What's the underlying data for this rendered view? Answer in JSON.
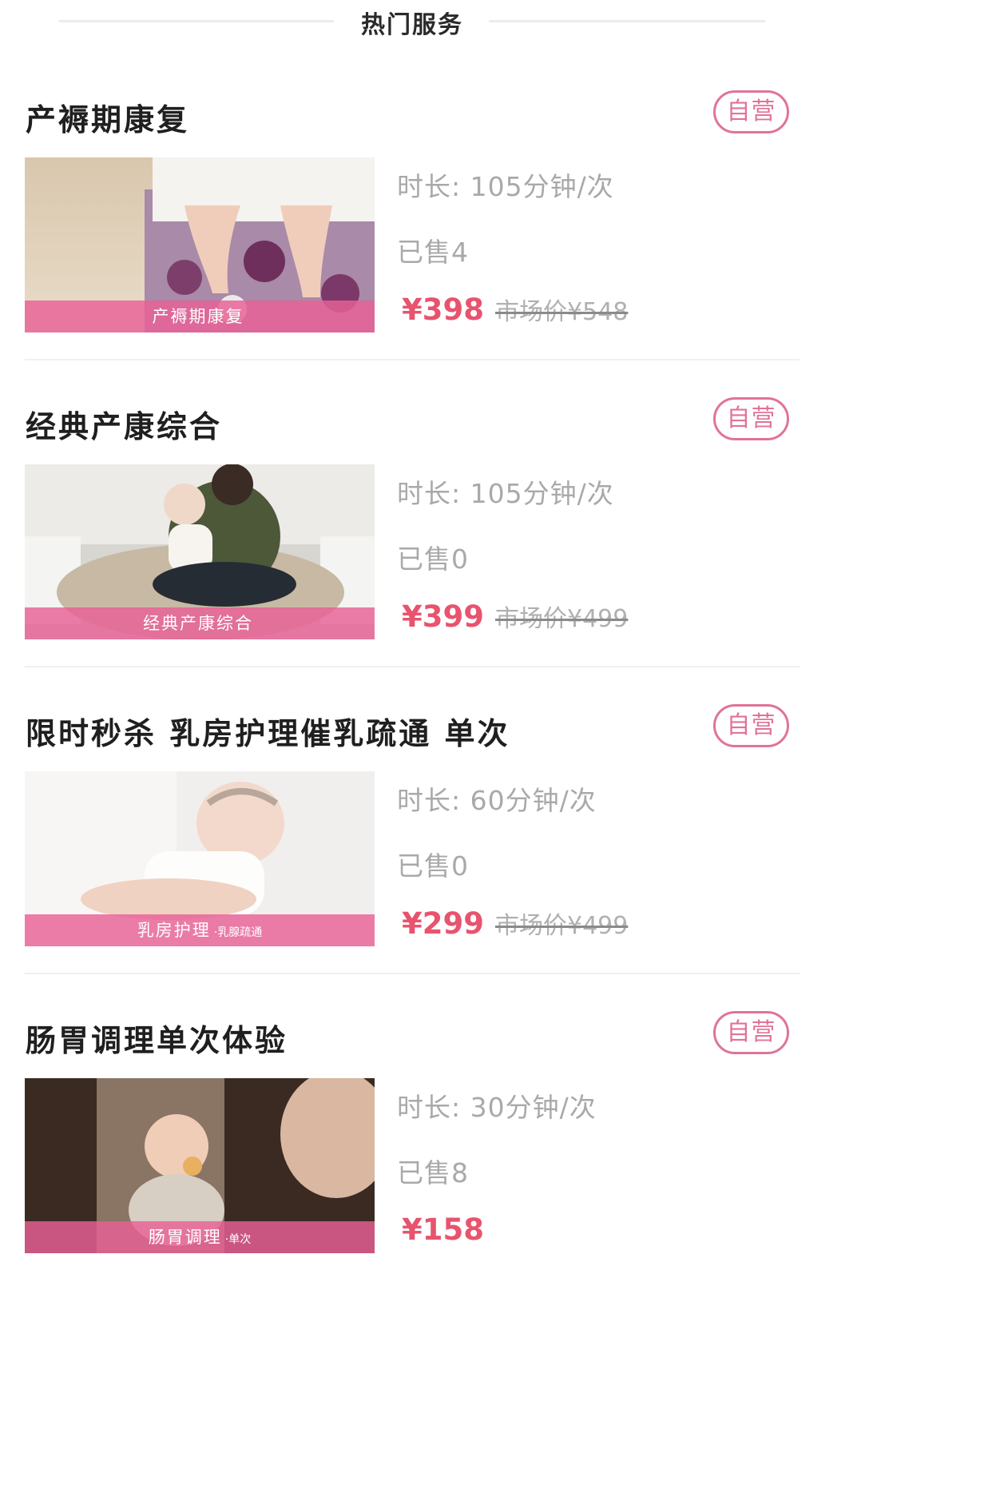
{
  "section": {
    "title": "热门服务"
  },
  "cards": [
    {
      "title": "产褥期康复",
      "badge": "自营",
      "caption": "产褥期康复",
      "caption_sub": "",
      "duration": "时长: 105分钟/次",
      "sold": "已售4",
      "price": "¥398",
      "old_price": "市场价¥548"
    },
    {
      "title": "经典产康综合",
      "badge": "自营",
      "caption": "经典产康综合",
      "caption_sub": "",
      "duration": "时长: 105分钟/次",
      "sold": "已售0",
      "price": "¥399",
      "old_price": "市场价¥499"
    },
    {
      "title": "限时秒杀 乳房护理催乳疏通 单次",
      "badge": "自营",
      "caption": "乳房护理",
      "caption_sub": "·乳腺疏通",
      "duration": "时长: 60分钟/次",
      "sold": "已售0",
      "price": "¥299",
      "old_price": "市场价¥499"
    },
    {
      "title": "肠胃调理单次体验",
      "badge": "自营",
      "caption": "肠胃调理",
      "caption_sub": "·单次",
      "duration": "时长: 30分钟/次",
      "sold": "已售8",
      "price": "¥158",
      "old_price": ""
    }
  ],
  "colors": {
    "accent": "#e8536e",
    "badge": "#e0739a",
    "caption_bg": "#e86096"
  }
}
